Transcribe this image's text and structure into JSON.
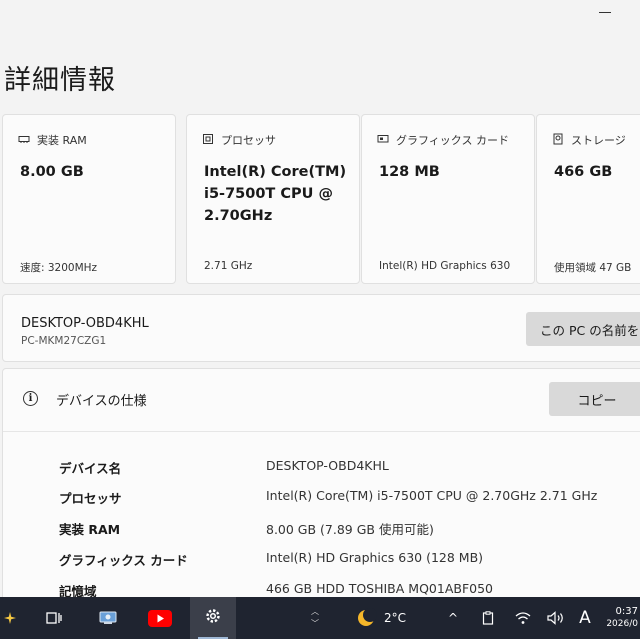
{
  "window": {
    "title": "詳細情報"
  },
  "cards": [
    {
      "label": "実装 RAM",
      "value": "8.00 GB",
      "footer": "速度: 3200MHz",
      "icon": "memory-icon"
    },
    {
      "label": "プロセッサ",
      "value": "Intel(R) Core(TM) i5-7500T CPU @ 2.70GHz",
      "footer": "2.71 GHz",
      "icon": "processor-icon"
    },
    {
      "label": "グラフィックス カード",
      "value": "128 MB",
      "footer": "Intel(R) HD Graphics 630",
      "icon": "graphics-card-icon"
    },
    {
      "label": "ストレージ",
      "value": "466 GB",
      "footer": "使用領域 47 GB",
      "icon": "storage-icon"
    }
  ],
  "pc": {
    "name": "DESKTOP-OBD4KHL",
    "model": "PC-MKM27CZG1",
    "rename_label": "この PC の名前を"
  },
  "specs": {
    "title": "デバイスの仕様",
    "copy_label": "コピー",
    "rows": [
      {
        "label": "デバイス名",
        "value": "DESKTOP-OBD4KHL"
      },
      {
        "label": "プロセッサ",
        "value": "Intel(R) Core(TM) i5-7500T CPU @ 2.70GHz   2.71 GHz"
      },
      {
        "label": "実装 RAM",
        "value": "8.00 GB (7.89 GB 使用可能)"
      },
      {
        "label": "グラフィックス カード",
        "value": "Intel(R) HD Graphics 630 (128 MB)"
      },
      {
        "label": "記憶域",
        "value": "466 GB HDD TOSHIBA MQ01ABF050"
      }
    ]
  },
  "taskbar": {
    "weather": "2°C",
    "ime": "A",
    "time": "0:37",
    "date": "2026/0"
  }
}
